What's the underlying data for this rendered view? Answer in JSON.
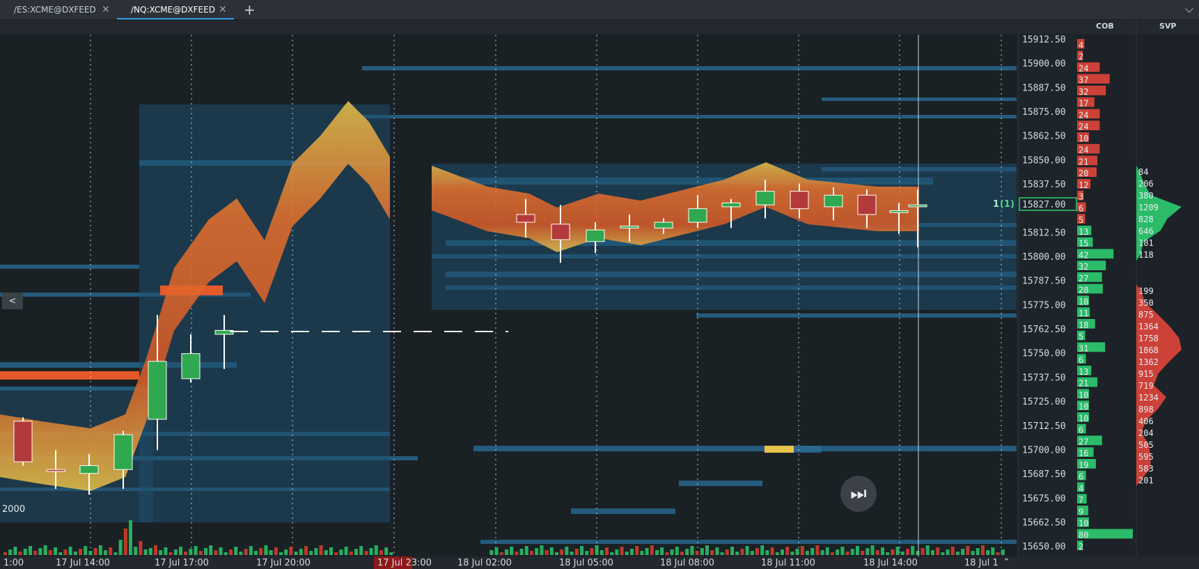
{
  "tabs": [
    {
      "label": "/ES:XCME@DXFEED",
      "active": false
    },
    {
      "label": "/NQ:XCME@DXFEED",
      "active": true
    }
  ],
  "columns": {
    "cob": "COB",
    "svp": "SVP"
  },
  "left_button": "<",
  "volume_scale_label": "2000",
  "price_axis": [
    "15912.50",
    "15900.00",
    "15887.50",
    "15875.00",
    "15862.50",
    "15850.00",
    "15837.50",
    "15827.00",
    "15812.50",
    "15800.00",
    "15787.50",
    "15775.00",
    "15762.50",
    "15750.00",
    "15737.50",
    "15725.00",
    "15712.50",
    "15700.00",
    "15687.50",
    "15675.00",
    "15662.50",
    "15650.00"
  ],
  "current_price": "15827.00",
  "position_label": "1",
  "position_qty": "(1)",
  "time_axis": [
    "1:00",
    "17 Jul 14:00",
    "17 Jul 17:00",
    "17 Jul 20:00",
    "17 Jul 23:00",
    "18 Jul 02:00",
    "18 Jul 05:00",
    "18 Jul 08:00",
    "18 Jul 11:00",
    "18 Jul 14:00",
    "18 Jul 1"
  ],
  "time_highlight": "17 Jul 23:00",
  "cob": {
    "values": [
      "4",
      "2",
      "24",
      "37",
      "32",
      "17",
      "24",
      "24",
      "10",
      "24",
      "21",
      "20",
      "12",
      "3",
      "6",
      "5",
      "13",
      "15",
      "42",
      "32",
      "27",
      "28",
      "10",
      "11",
      "18",
      "5",
      "31",
      "6",
      "13",
      "21",
      "10",
      "10",
      "10",
      "6",
      "27",
      "16",
      "19",
      "6",
      "4",
      "7",
      "9",
      "10",
      "80",
      "2"
    ],
    "colors": {
      "ask": "#e0453b",
      "bid": "#2ecc71"
    }
  },
  "svp": {
    "upper": [
      "84",
      "206",
      "380",
      "1209",
      "828",
      "646",
      "181",
      "118"
    ],
    "lower": [
      "199",
      "350",
      "875",
      "1364",
      "1758",
      "1868",
      "1362",
      "915",
      "719",
      "1234",
      "898",
      "406",
      "204",
      "505",
      "595",
      "583",
      "201"
    ],
    "colors": {
      "upper": "#2ecc71",
      "lower": "#e0453b"
    }
  },
  "chart_data": {
    "type": "candlestick",
    "candles": [
      {
        "t": "17 Jul 12:00",
        "o": 15715,
        "h": 15717,
        "l": 15692,
        "c": 15694
      },
      {
        "t": "17 Jul 13:00",
        "o": 15690,
        "h": 15700,
        "l": 15680,
        "c": 15689
      },
      {
        "t": "17 Jul 14:00",
        "o": 15688,
        "h": 15698,
        "l": 15677,
        "c": 15692
      },
      {
        "t": "17 Jul 15:00",
        "o": 15690,
        "h": 15710,
        "l": 15680,
        "c": 15708
      },
      {
        "t": "17 Jul 16:00",
        "o": 15716,
        "h": 15770,
        "l": 15700,
        "c": 15746
      },
      {
        "t": "17 Jul 17:00",
        "o": 15737,
        "h": 15760,
        "l": 15735,
        "c": 15750
      },
      {
        "t": "17 Jul 18:00",
        "o": 15760,
        "h": 15770,
        "l": 15742,
        "c": 15762
      },
      {
        "t": "18 Jul 03:00",
        "o": 15822,
        "h": 15830,
        "l": 15810,
        "c": 15818
      },
      {
        "t": "18 Jul 04:00",
        "o": 15817,
        "h": 15827,
        "l": 15797,
        "c": 15809
      },
      {
        "t": "18 Jul 05:00",
        "o": 15808,
        "h": 15818,
        "l": 15802,
        "c": 15814
      },
      {
        "t": "18 Jul 06:00",
        "o": 15815,
        "h": 15822,
        "l": 15808,
        "c": 15816
      },
      {
        "t": "18 Jul 07:00",
        "o": 15815,
        "h": 15820,
        "l": 15812,
        "c": 15818
      },
      {
        "t": "18 Jul 08:00",
        "o": 15818,
        "h": 15832,
        "l": 15815,
        "c": 15825
      },
      {
        "t": "18 Jul 09:00",
        "o": 15826,
        "h": 15830,
        "l": 15815,
        "c": 15828
      },
      {
        "t": "18 Jul 10:00",
        "o": 15827,
        "h": 15840,
        "l": 15820,
        "c": 15834
      },
      {
        "t": "18 Jul 11:00",
        "o": 15834,
        "h": 15838,
        "l": 15820,
        "c": 15825
      },
      {
        "t": "18 Jul 12:00",
        "o": 15826,
        "h": 15836,
        "l": 15819,
        "c": 15832
      },
      {
        "t": "18 Jul 13:00",
        "o": 15832,
        "h": 15835,
        "l": 15815,
        "c": 15822
      },
      {
        "t": "18 Jul 14:00",
        "o": 15823,
        "h": 15828,
        "l": 15812,
        "c": 15824
      },
      {
        "t": "18 Jul 15:00",
        "o": 15826,
        "h": 15835,
        "l": 15805,
        "c": 15827
      }
    ],
    "ylim": [
      15645,
      15915
    ],
    "ask_levels": [
      15900,
      15895,
      15850,
      15845
    ],
    "bid_levels": [
      15810,
      15805,
      15800,
      15785,
      15780,
      15750,
      15737,
      15650
    ]
  }
}
